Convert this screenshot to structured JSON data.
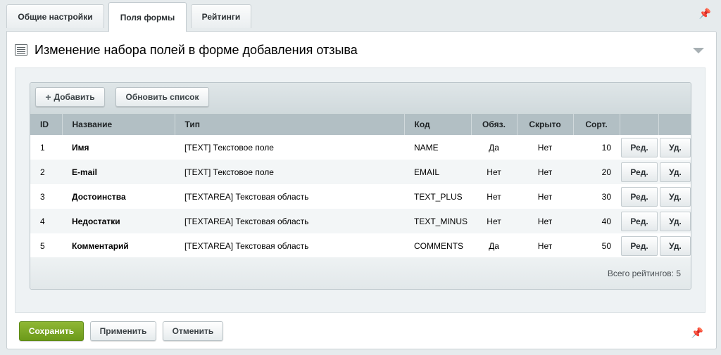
{
  "tabs": [
    {
      "label": "Общие настройки"
    },
    {
      "label": "Поля формы",
      "active": true
    },
    {
      "label": "Рейтинги"
    }
  ],
  "panel": {
    "title": "Изменение набора полей в форме добавления отзыва"
  },
  "toolbar": {
    "add_label": "Добавить",
    "refresh_label": "Обновить список"
  },
  "table": {
    "columns": [
      "ID",
      "Название",
      "Тип",
      "Код",
      "Обяз.",
      "Скрыто",
      "Сорт."
    ],
    "rows": [
      {
        "id": "1",
        "name": "Имя",
        "type": "[TEXT] Текстовое поле",
        "code": "NAME",
        "required": "Да",
        "hidden": "Нет",
        "sort": "10"
      },
      {
        "id": "2",
        "name": "E-mail",
        "type": "[TEXT] Текстовое поле",
        "code": "EMAIL",
        "required": "Нет",
        "hidden": "Нет",
        "sort": "20"
      },
      {
        "id": "3",
        "name": "Достоинства",
        "type": "[TEXTAREA] Текстовая область",
        "code": "TEXT_PLUS",
        "required": "Нет",
        "hidden": "Нет",
        "sort": "30"
      },
      {
        "id": "4",
        "name": "Недостатки",
        "type": "[TEXTAREA] Текстовая область",
        "code": "TEXT_MINUS",
        "required": "Нет",
        "hidden": "Нет",
        "sort": "40"
      },
      {
        "id": "5",
        "name": "Комментарий",
        "type": "[TEXTAREA] Текстовая область",
        "code": "COMMENTS",
        "required": "Да",
        "hidden": "Нет",
        "sort": "50"
      }
    ],
    "edit_label": "Ред.",
    "delete_label": "Уд.",
    "footer": "Всего рейтингов: 5"
  },
  "actions": {
    "save_label": "Сохранить",
    "apply_label": "Применить",
    "cancel_label": "Отменить"
  },
  "icons": {
    "pin": "pin-icon",
    "collapse": "chevron-down-icon",
    "form": "form-icon",
    "add": "plus-icon"
  },
  "colors": {
    "save_button": "#7aa624",
    "table_header": "#b2bfc4"
  }
}
